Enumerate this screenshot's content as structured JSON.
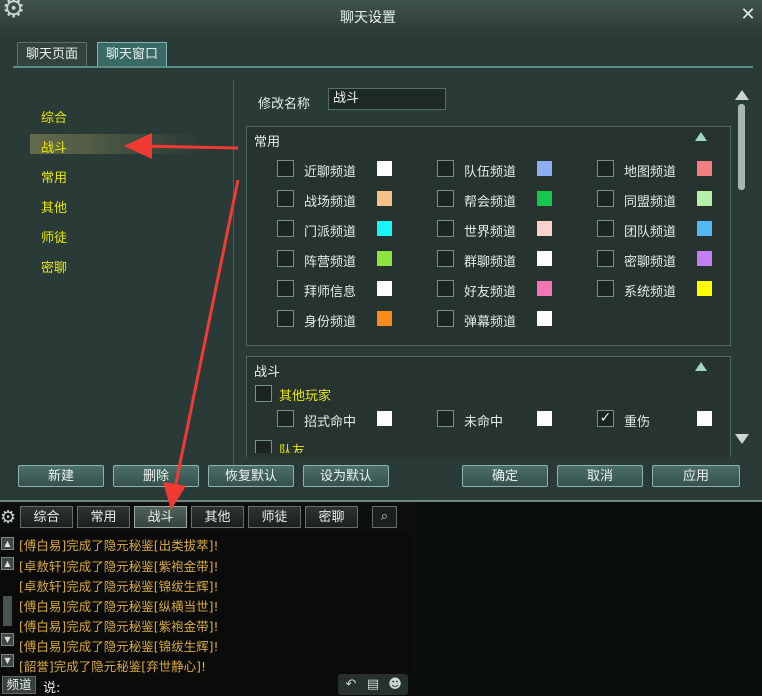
{
  "dialog": {
    "title": "聊天设置",
    "close_icon": "close-icon",
    "tabs": [
      "聊天页面",
      "聊天窗口"
    ],
    "active_tab": "聊天窗口"
  },
  "sidebar": {
    "items": [
      "综合",
      "战斗",
      "常用",
      "其他",
      "师徒",
      "密聊"
    ],
    "selected": "战斗"
  },
  "rename": {
    "label": "修改名称",
    "value": "战斗"
  },
  "common_group": {
    "title": "常用",
    "channels": [
      {
        "label": "近聊频道",
        "color": "#ffffff",
        "checked": false
      },
      {
        "label": "队伍频道",
        "color": "#8caef0",
        "checked": false
      },
      {
        "label": "地图频道",
        "color": "#f27f7f",
        "checked": false
      },
      {
        "label": "战场频道",
        "color": "#f8c089",
        "checked": false
      },
      {
        "label": "帮会频道",
        "color": "#15c74f",
        "checked": false
      },
      {
        "label": "同盟频道",
        "color": "#b6eeae",
        "checked": false
      },
      {
        "label": "门派频道",
        "color": "#19f4f4",
        "checked": false
      },
      {
        "label": "世界频道",
        "color": "#fbd2d0",
        "checked": false
      },
      {
        "label": "团队频道",
        "color": "#52b9f3",
        "checked": false
      },
      {
        "label": "阵营频道",
        "color": "#8fe33e",
        "checked": false
      },
      {
        "label": "群聊频道",
        "color": "#ffffff",
        "checked": false
      },
      {
        "label": "密聊频道",
        "color": "#c27ff3",
        "checked": false
      },
      {
        "label": "拜师信息",
        "color": "#ffffff",
        "checked": false
      },
      {
        "label": "好友频道",
        "color": "#f277b4",
        "checked": false
      },
      {
        "label": "系统频道",
        "color": "#ffff00",
        "checked": false
      },
      {
        "label": "身份频道",
        "color": "#f98a1d",
        "checked": false
      },
      {
        "label": "弹幕频道",
        "color": "#ffffff",
        "checked": false
      }
    ]
  },
  "battle_group": {
    "title": "战斗",
    "other_players": "其他玩家",
    "items": [
      {
        "label": "招式命中",
        "color": "#ffffff",
        "checked": false
      },
      {
        "label": "未命中",
        "color": "#ffffff",
        "checked": false
      },
      {
        "label": "重伤",
        "color": "#ffffff",
        "checked": true
      }
    ],
    "team": "队友"
  },
  "buttons": {
    "new": "新建",
    "delete": "删除",
    "restore": "恢复默认",
    "set_default": "设为默认",
    "ok": "确定",
    "cancel": "取消",
    "apply": "应用"
  },
  "chat": {
    "tabs": [
      "综合",
      "常用",
      "战斗",
      "其他",
      "师徒",
      "密聊"
    ],
    "active_tab": "战斗",
    "messages": [
      "[傅白易]完成了隐元秘鉴[出类拔萃]!",
      "[卓敖轩]完成了隐元秘鉴[紫袍金带]!",
      "[卓敖轩]完成了隐元秘鉴[锦绂生辉]!",
      "[傅白易]完成了隐元秘鉴[纵横当世]!",
      "[傅白易]完成了隐元秘鉴[紫袍金带]!",
      "[傅白易]完成了隐元秘鉴[锦绂生辉]!",
      "[韶誉]完成了隐元秘鉴[弃世静心]!"
    ],
    "channel_label": "频道",
    "say_label": "说:"
  }
}
